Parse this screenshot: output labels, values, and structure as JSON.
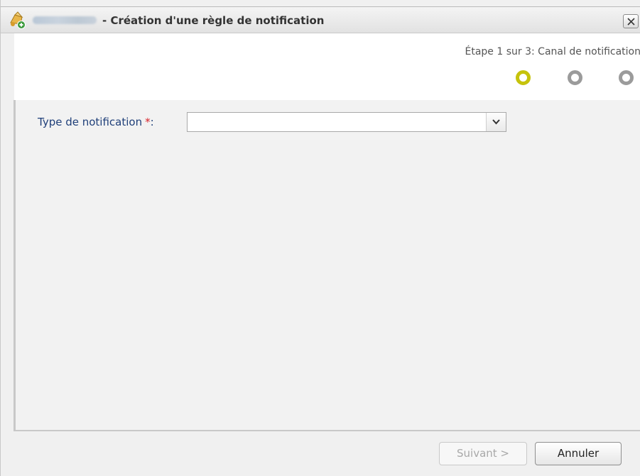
{
  "dialog": {
    "title": "- Création d'une règle de notification",
    "app_icon": "notification-rule-add-icon",
    "close_icon": "close-icon"
  },
  "wizard": {
    "step_text": "Étape 1 sur 3: Canal de notification",
    "current_step": 1,
    "total_steps": 3,
    "active_color": "#c6c30c",
    "inactive_color": "#9b9b9b"
  },
  "form": {
    "notification_type_label": "Type de notification",
    "required_marker": "*",
    "colon": ":",
    "notification_type_value": "",
    "dropdown_icon": "chevron-down-icon",
    "label_color": "#1f3f79",
    "required_color": "#d9232a"
  },
  "footer": {
    "next_label": "Suivant >",
    "cancel_label": "Annuler"
  }
}
